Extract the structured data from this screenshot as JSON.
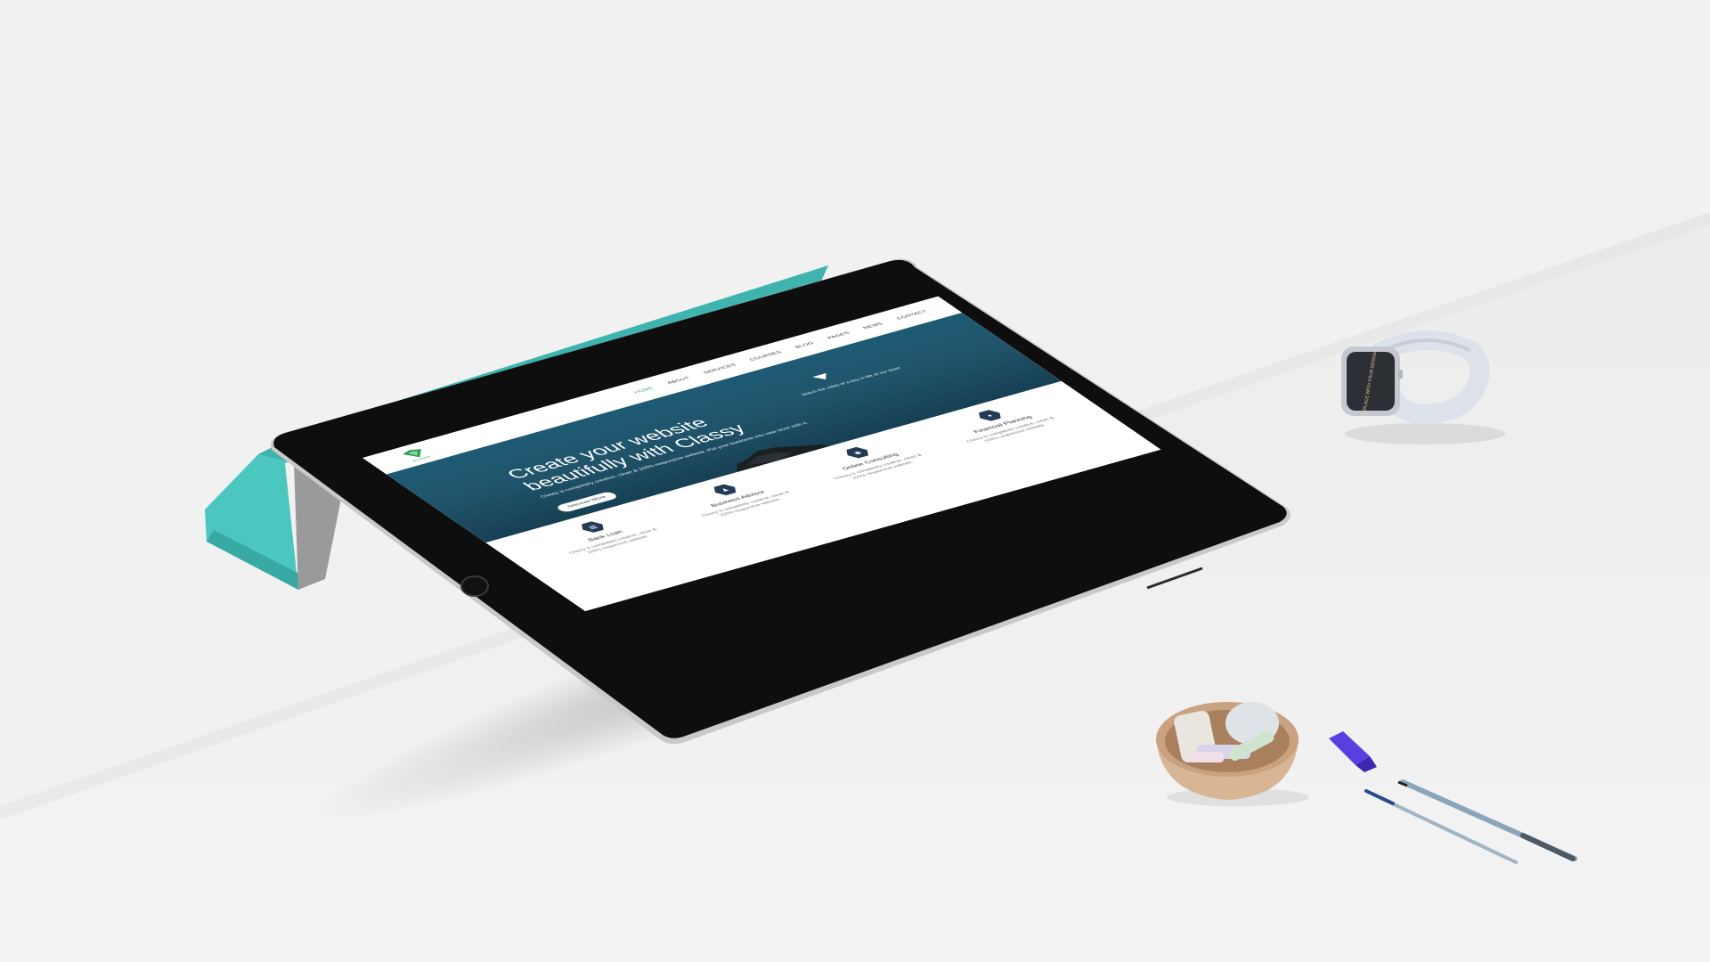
{
  "scene": {
    "background": "#f1f1f1",
    "table_edge_color": "#e6e6e6",
    "objects": [
      "tablet",
      "smart-cover",
      "smartwatch",
      "wooden-bowl",
      "pen",
      "pen-cap"
    ]
  },
  "site": {
    "logo_text": "CLASSY",
    "nav": [
      "HOME",
      "ABOUT",
      "SERVICES",
      "COURSES",
      "BLOG",
      "PAGES",
      "NEWS",
      "CONTACT"
    ],
    "active_nav_index": 0,
    "hero": {
      "title_line1": "Create your website",
      "title_line2": "beautifully with Classy",
      "text": "Classy is completely creative, clean & 100% responsive website. Put your business into new level with it.",
      "button": "Discover More",
      "video_label": "Watch the video of a day in life of our team"
    },
    "services": [
      {
        "icon": "bank-icon",
        "glyph": "▤",
        "title": "Bank Loan",
        "text": "Classy is completely creative, clean & 100% responsive website."
      },
      {
        "icon": "advisor-icon",
        "glyph": "♟",
        "title": "Business Advisor",
        "text": "Classy is completely creative, clean & 100% responsive website."
      },
      {
        "icon": "consulting-icon",
        "glyph": "◉",
        "title": "Online Consulting",
        "text": "Classy is completely creative, clean & 100% responsive website."
      },
      {
        "icon": "planning-icon",
        "glyph": "♦",
        "title": "Financial Planning",
        "text": "Classy is completely creative, clean & 100% responsive website."
      }
    ]
  },
  "watch": {
    "face_text": "REPLACE WITH YOUR DESIGN"
  },
  "colors": {
    "cover": "#4cc7c0",
    "tablet_body": "#0e0e0e",
    "hero_sea": "#1e5a73",
    "accent_green": "#2fb36a",
    "service_hex": "#243b55",
    "bowl": "#d9b79a",
    "pen": "#6e8ea6",
    "pen_cap": "#5a3fe0"
  }
}
